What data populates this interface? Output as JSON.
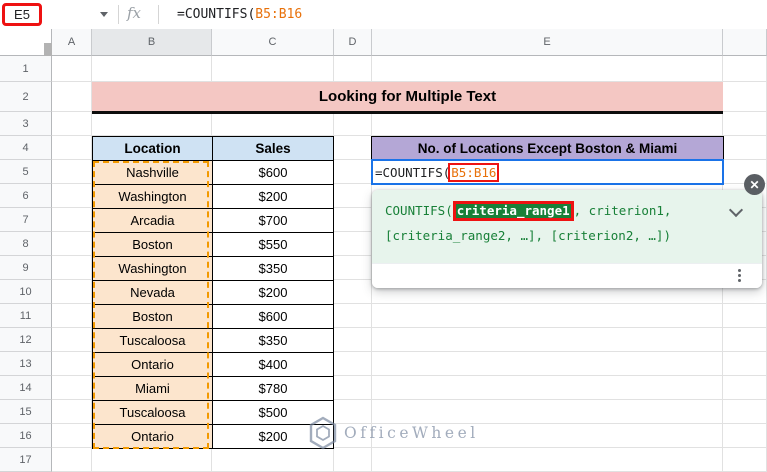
{
  "name_box": {
    "value": "E5"
  },
  "formula_bar": {
    "fx_label": "fx",
    "prefix": "=COUNTIFS(",
    "range": "B5:B16"
  },
  "sheet": {
    "column_headers": [
      "A",
      "B",
      "C",
      "D",
      "E",
      ""
    ],
    "highlighted_column": "B",
    "row_headers": [
      "1",
      "2",
      "3",
      "4",
      "5",
      "6",
      "7",
      "8",
      "9",
      "10",
      "11",
      "12",
      "13",
      "14",
      "15",
      "16",
      "17"
    ]
  },
  "banner": {
    "text": "Looking for Multiple Text",
    "bg": "#f4c7c3"
  },
  "table": {
    "headers": [
      "Location",
      "Sales"
    ],
    "rows": [
      [
        "Nashville",
        "$600"
      ],
      [
        "Washington",
        "$200"
      ],
      [
        "Arcadia",
        "$700"
      ],
      [
        "Boston",
        "$550"
      ],
      [
        "Washington",
        "$350"
      ],
      [
        "Nevada",
        "$200"
      ],
      [
        "Boston",
        "$600"
      ],
      [
        "Tuscaloosa",
        "$350"
      ],
      [
        "Ontario",
        "$400"
      ],
      [
        "Miami",
        "$780"
      ],
      [
        "Tuscaloosa",
        "$500"
      ],
      [
        "Ontario",
        "$200"
      ]
    ]
  },
  "result_header": {
    "text": "No. of Locations Except Boston & Miami",
    "bg": "#b4a7d6"
  },
  "cell_editor": {
    "prefix": "=COUNTIFS(",
    "range": "B5:B16"
  },
  "popup": {
    "fn": "COUNTIFS(",
    "arg": "criteria_range1",
    "after_arg": ", criterion1,",
    "line2": "[criteria_range2, …], [criterion2, …])",
    "close_label": "✕"
  },
  "watermark": {
    "text": "OfficeWheel"
  },
  "colors": {
    "annotation_red": "#ee1212",
    "range_orange": "#e8710a",
    "ants_orange": "#f29900",
    "banner_pink": "#f4c7c3",
    "table_header_blue": "#cfe2f3",
    "location_fill": "#fce5cd",
    "result_purple": "#b4a7d6",
    "edit_border_blue": "#1a73e8",
    "popup_green_bg": "#e7f4ec",
    "popup_green_text": "#188038"
  }
}
